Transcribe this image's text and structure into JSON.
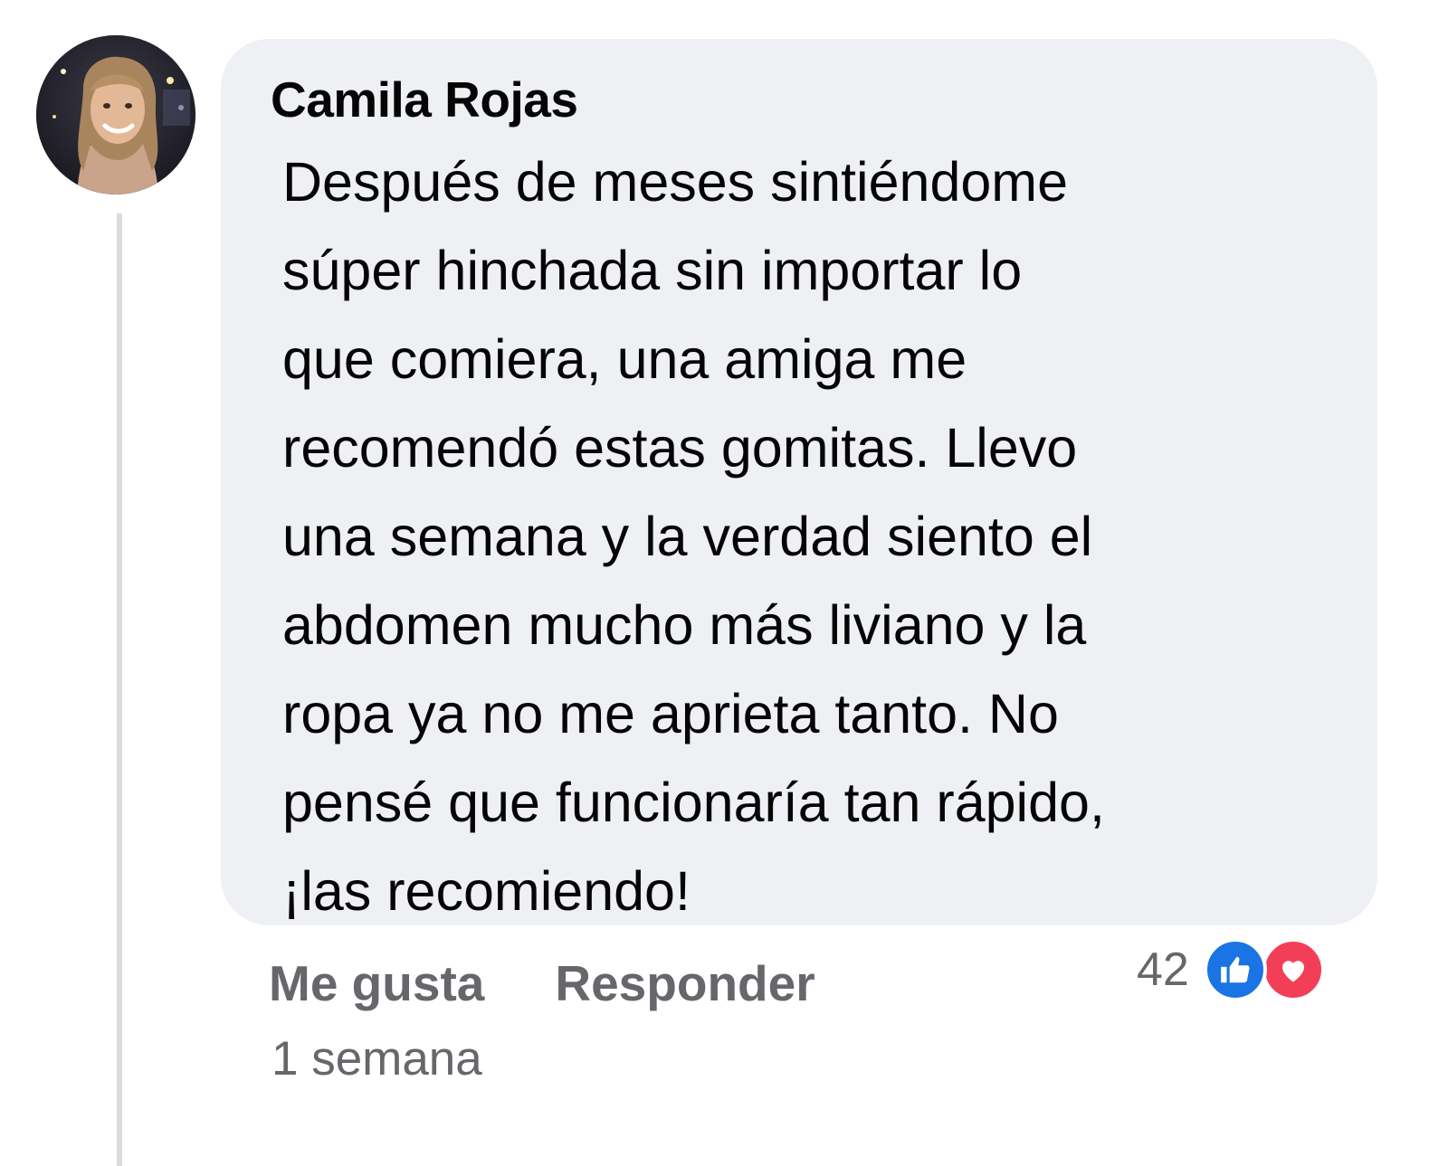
{
  "comment": {
    "author": "Camila Rojas",
    "avatar_icon": "profile-photo",
    "text_lines": [
      "Después de meses sintiéndome",
      "súper hinchada sin importar lo",
      "que comiera, una amiga me",
      "recomendó estas gomitas. Llevo",
      "una semana y la verdad siento el",
      "abdomen mucho más liviano y la",
      "ropa ya no me aprieta tanto. No",
      "pensé que funcionaría tan rápido,",
      "¡las recomiendo!"
    ],
    "bubble_color": "#eef0f3"
  },
  "actions": {
    "like_label": "Me gusta",
    "reply_label": "Responder"
  },
  "timestamp": "1 semana",
  "reactions": {
    "count": "42",
    "icons": [
      "like-icon",
      "love-icon"
    ],
    "like_color": "#1b74e4",
    "love_color": "#f33e58"
  }
}
